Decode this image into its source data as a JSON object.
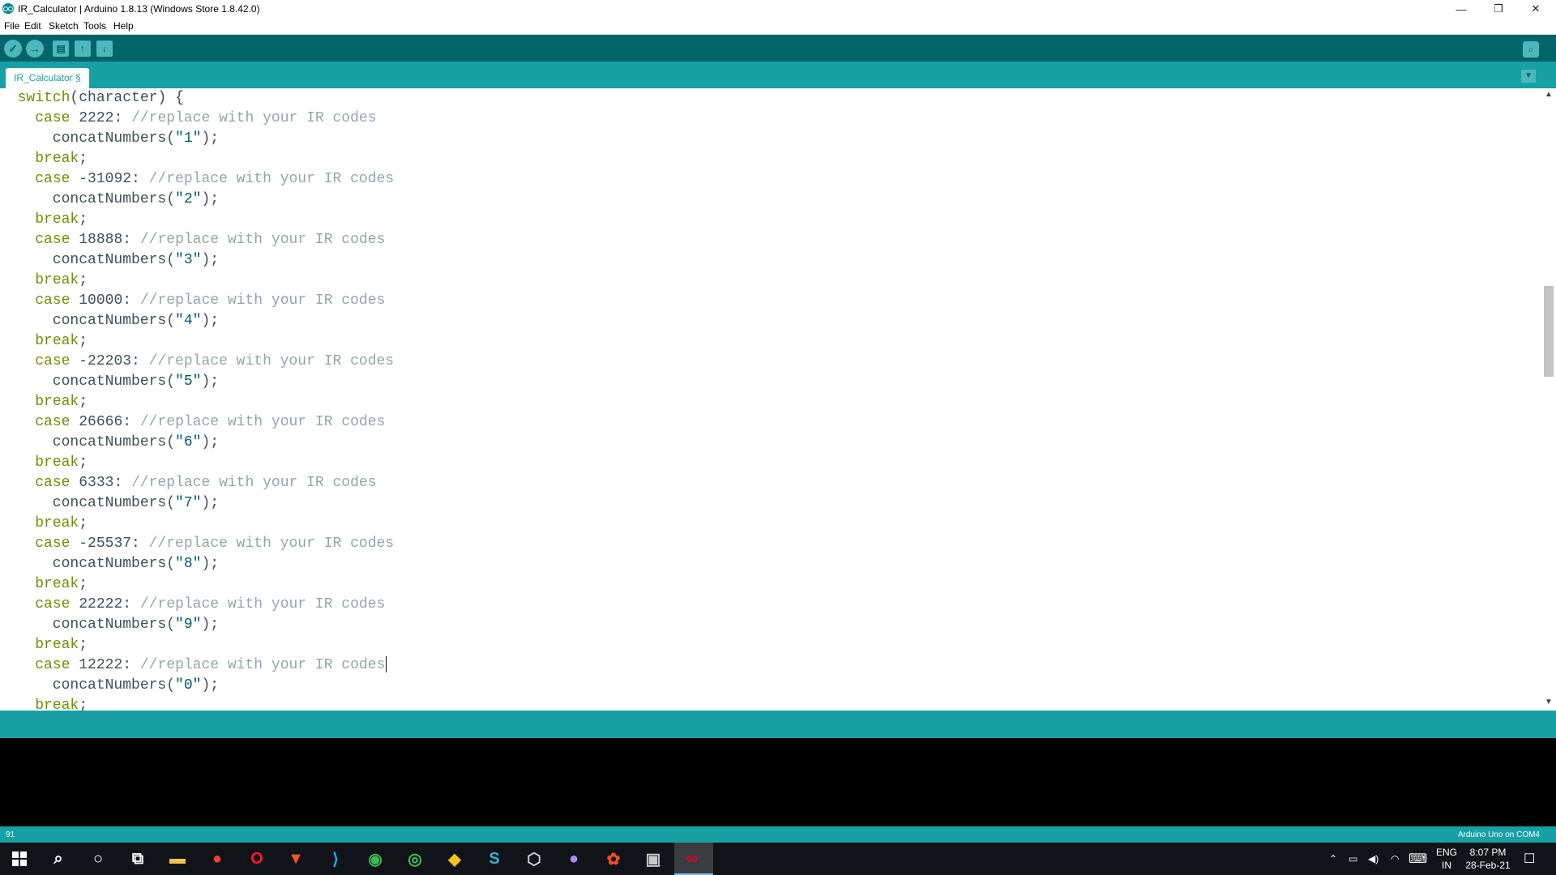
{
  "window": {
    "title": "IR_Calculator | Arduino 1.8.13 (Windows Store 1.8.42.0)",
    "minimize_glyph": "—",
    "restore_glyph": "❐",
    "close_glyph": "✕"
  },
  "menu": [
    "File",
    "Edit",
    "Sketch",
    "Tools",
    "Help"
  ],
  "toolbar": {
    "verify_glyph": "✓",
    "upload_glyph": "→",
    "new_glyph": "▤",
    "open_glyph": "↑",
    "save_glyph": "↓",
    "serial_glyph": "⌕"
  },
  "tabs": [
    {
      "label": "IR_Calculator §"
    }
  ],
  "tab_menu_glyph": "▼",
  "editor": {
    "lines": [
      [
        {
          "t": "  "
        },
        {
          "t": "switch",
          "c": "kw"
        },
        {
          "t": "(character) {"
        }
      ],
      [
        {
          "t": "    "
        },
        {
          "t": "case",
          "c": "kw"
        },
        {
          "t": " 2222: "
        },
        {
          "t": "//replace with your IR codes",
          "c": "cm"
        }
      ],
      [
        {
          "t": "      concatNumbers("
        },
        {
          "t": "\"1\"",
          "c": "str"
        },
        {
          "t": ");"
        }
      ],
      [
        {
          "t": "    "
        },
        {
          "t": "break",
          "c": "kw"
        },
        {
          "t": ";"
        }
      ],
      [
        {
          "t": "    "
        },
        {
          "t": "case",
          "c": "kw"
        },
        {
          "t": " -31092: "
        },
        {
          "t": "//replace with your IR codes",
          "c": "cm"
        }
      ],
      [
        {
          "t": "      concatNumbers("
        },
        {
          "t": "\"2\"",
          "c": "str"
        },
        {
          "t": ");"
        }
      ],
      [
        {
          "t": "    "
        },
        {
          "t": "break",
          "c": "kw"
        },
        {
          "t": ";"
        }
      ],
      [
        {
          "t": "    "
        },
        {
          "t": "case",
          "c": "kw"
        },
        {
          "t": " 18888: "
        },
        {
          "t": "//replace with your IR codes",
          "c": "cm"
        }
      ],
      [
        {
          "t": "      concatNumbers("
        },
        {
          "t": "\"3\"",
          "c": "str"
        },
        {
          "t": ");"
        }
      ],
      [
        {
          "t": "    "
        },
        {
          "t": "break",
          "c": "kw"
        },
        {
          "t": ";"
        }
      ],
      [
        {
          "t": "    "
        },
        {
          "t": "case",
          "c": "kw"
        },
        {
          "t": " 10000: "
        },
        {
          "t": "//replace with your IR codes",
          "c": "cm"
        }
      ],
      [
        {
          "t": "      concatNumbers("
        },
        {
          "t": "\"4\"",
          "c": "str"
        },
        {
          "t": ");"
        }
      ],
      [
        {
          "t": "    "
        },
        {
          "t": "break",
          "c": "kw"
        },
        {
          "t": ";"
        }
      ],
      [
        {
          "t": "    "
        },
        {
          "t": "case",
          "c": "kw"
        },
        {
          "t": " -22203: "
        },
        {
          "t": "//replace with your IR codes",
          "c": "cm"
        }
      ],
      [
        {
          "t": "      concatNumbers("
        },
        {
          "t": "\"5\"",
          "c": "str"
        },
        {
          "t": ");"
        }
      ],
      [
        {
          "t": "    "
        },
        {
          "t": "break",
          "c": "kw"
        },
        {
          "t": ";"
        }
      ],
      [
        {
          "t": "    "
        },
        {
          "t": "case",
          "c": "kw"
        },
        {
          "t": " 26666: "
        },
        {
          "t": "//replace with your IR codes",
          "c": "cm"
        }
      ],
      [
        {
          "t": "      concatNumbers("
        },
        {
          "t": "\"6\"",
          "c": "str"
        },
        {
          "t": ");"
        }
      ],
      [
        {
          "t": "    "
        },
        {
          "t": "break",
          "c": "kw"
        },
        {
          "t": ";"
        }
      ],
      [
        {
          "t": "    "
        },
        {
          "t": "case",
          "c": "kw"
        },
        {
          "t": " 6333: "
        },
        {
          "t": "//replace with your IR codes",
          "c": "cm"
        }
      ],
      [
        {
          "t": "      concatNumbers("
        },
        {
          "t": "\"7\"",
          "c": "str"
        },
        {
          "t": ");"
        }
      ],
      [
        {
          "t": "    "
        },
        {
          "t": "break",
          "c": "kw"
        },
        {
          "t": ";"
        }
      ],
      [
        {
          "t": "    "
        },
        {
          "t": "case",
          "c": "kw"
        },
        {
          "t": " -25537: "
        },
        {
          "t": "//replace with your IR codes",
          "c": "cm"
        }
      ],
      [
        {
          "t": "      concatNumbers("
        },
        {
          "t": "\"8\"",
          "c": "str"
        },
        {
          "t": ");"
        }
      ],
      [
        {
          "t": "    "
        },
        {
          "t": "break",
          "c": "kw"
        },
        {
          "t": ";"
        }
      ],
      [
        {
          "t": "    "
        },
        {
          "t": "case",
          "c": "kw"
        },
        {
          "t": " 22222: "
        },
        {
          "t": "//replace with your IR codes",
          "c": "cm"
        }
      ],
      [
        {
          "t": "      concatNumbers("
        },
        {
          "t": "\"9\"",
          "c": "str"
        },
        {
          "t": ");"
        }
      ],
      [
        {
          "t": "    "
        },
        {
          "t": "break",
          "c": "kw"
        },
        {
          "t": ";"
        }
      ],
      [
        {
          "t": "    "
        },
        {
          "t": "case",
          "c": "kw"
        },
        {
          "t": " 12222: "
        },
        {
          "t": "//replace with your IR codes",
          "c": "cm"
        },
        {
          "caret": true
        }
      ],
      [
        {
          "t": "      concatNumbers("
        },
        {
          "t": "\"0\"",
          "c": "str"
        },
        {
          "t": ");"
        }
      ],
      [
        {
          "t": "    "
        },
        {
          "t": "break",
          "c": "kw"
        },
        {
          "t": ";"
        }
      ]
    ]
  },
  "statusbar": {
    "line_number": "91",
    "board": "Arduino Uno on COM4"
  },
  "taskbar": {
    "apps": [
      {
        "name": "search-icon",
        "glyph": "⌕",
        "color": "#ffffff"
      },
      {
        "name": "cortana-icon",
        "glyph": "○",
        "color": "#ffffff"
      },
      {
        "name": "task-view-icon",
        "glyph": "⧉",
        "color": "#ffffff"
      },
      {
        "name": "file-explorer-icon",
        "glyph": "▬",
        "color": "#f2c14e"
      },
      {
        "name": "chrome-icon",
        "glyph": "●",
        "color": "#e94235"
      },
      {
        "name": "opera-icon",
        "glyph": "O",
        "color": "#ff1b2d"
      },
      {
        "name": "brave-icon",
        "glyph": "▼",
        "color": "#fb542b"
      },
      {
        "name": "vscode-icon",
        "glyph": "⟩",
        "color": "#23a9f2"
      },
      {
        "name": "globe-app-icon",
        "glyph": "◉",
        "color": "#3fb950"
      },
      {
        "name": "maps-app-icon",
        "glyph": "◎",
        "color": "#34c759"
      },
      {
        "name": "git-icon",
        "glyph": "◆",
        "color": "#f5c518"
      },
      {
        "name": "slack-app-icon",
        "glyph": "S",
        "color": "#2bb5d6"
      },
      {
        "name": "box-app-icon",
        "glyph": "⬡",
        "color": "#d0d4d8"
      },
      {
        "name": "color-app-icon",
        "glyph": "●",
        "color": "#a78bfa"
      },
      {
        "name": "figma-icon",
        "glyph": "✿",
        "color": "#f24e1e"
      },
      {
        "name": "window-app-icon",
        "glyph": "▣",
        "color": "#c8c8c8"
      },
      {
        "name": "arduino-taskbar-icon",
        "glyph": "∞",
        "color": "#e4002b"
      }
    ],
    "tray_up_glyph": "⌃",
    "battery_glyph": "▭",
    "volume_glyph": "◀)",
    "wifi_glyph": "◠",
    "keyboard_glyph": "⌨",
    "lang_top": "ENG",
    "lang_bottom": "IN",
    "time": "8:07 PM",
    "date": "28-Feb-21",
    "notification_glyph": "☐"
  },
  "colors": {
    "toolbar_bg": "#006468",
    "tab_bg": "#17a1a5",
    "keyword": "#728e00",
    "comment": "#95a5a6",
    "string": "#005c5f"
  }
}
